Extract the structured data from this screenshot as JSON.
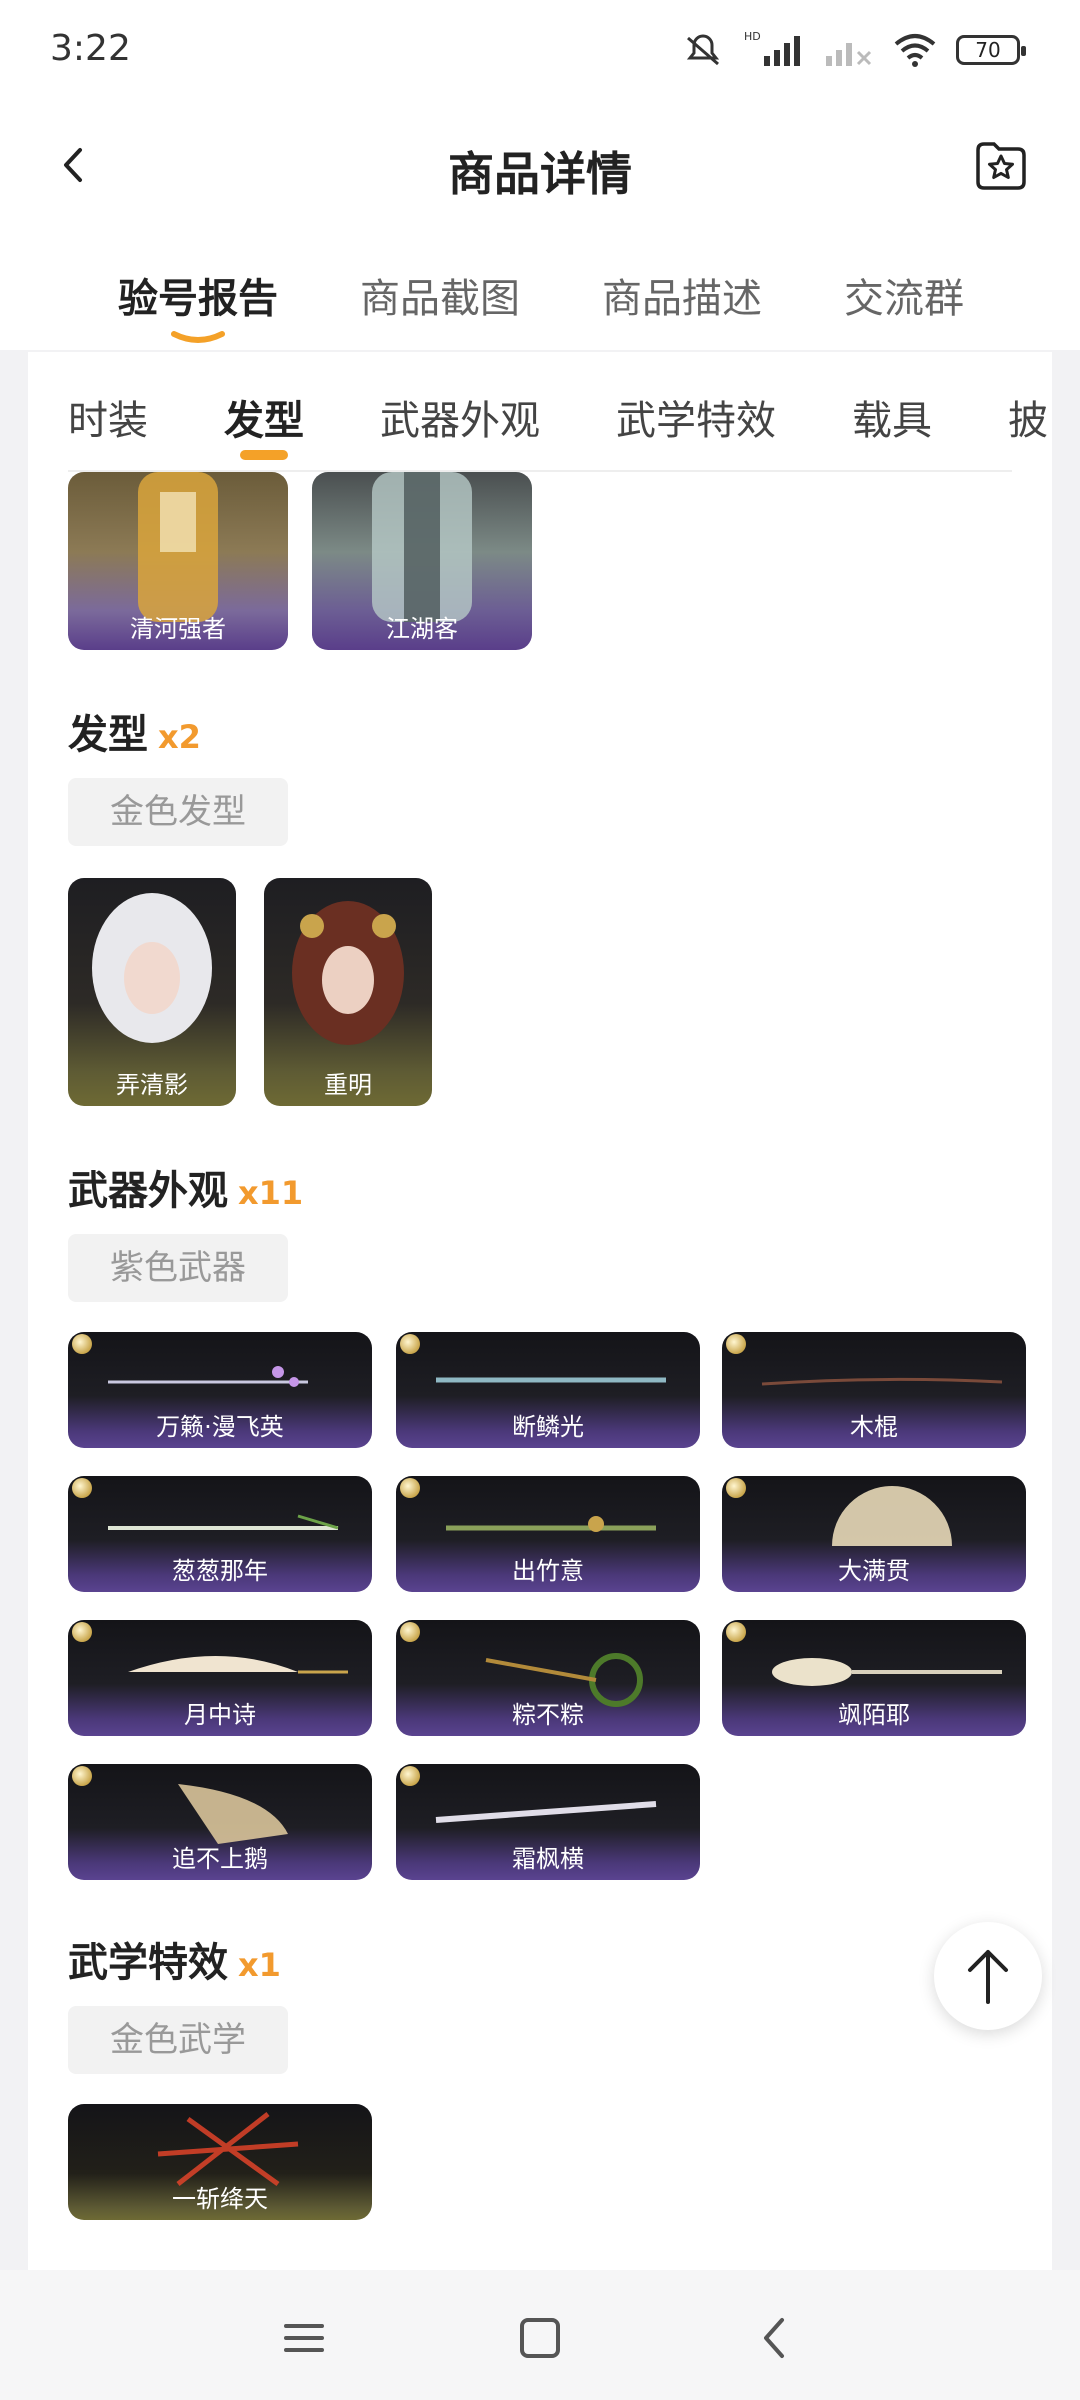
{
  "status_bar": {
    "time": "3:22",
    "battery": "70",
    "network_label": "HD"
  },
  "header": {
    "title": "商品详情"
  },
  "main_tabs": [
    {
      "label": "验号报告",
      "active": true
    },
    {
      "label": "商品截图",
      "active": false
    },
    {
      "label": "商品描述",
      "active": false
    },
    {
      "label": "交流群",
      "active": false
    }
  ],
  "sub_tabs": [
    {
      "label": "时装",
      "active": false
    },
    {
      "label": "发型",
      "active": true
    },
    {
      "label": "武器外观",
      "active": false
    },
    {
      "label": "武学特效",
      "active": false
    },
    {
      "label": "载具",
      "active": false
    },
    {
      "label": "披",
      "active": false
    }
  ],
  "outfits": [
    {
      "name": "清河强者"
    },
    {
      "name": "江湖客"
    }
  ],
  "hair": {
    "title": "发型",
    "count": "x2",
    "filter_chip": "金色发型",
    "items": [
      {
        "name": "弄清影"
      },
      {
        "name": "重明"
      }
    ]
  },
  "weapons": {
    "title": "武器外观",
    "count": "x11",
    "filter_chip": "紫色武器",
    "items": [
      {
        "name": "万籁·漫飞英"
      },
      {
        "name": "断鳞光"
      },
      {
        "name": "木棍"
      },
      {
        "name": "葱葱那年"
      },
      {
        "name": "出竹意"
      },
      {
        "name": "大满贯"
      },
      {
        "name": "月中诗"
      },
      {
        "name": "粽不粽"
      },
      {
        "name": "飒陌耶"
      },
      {
        "name": "追不上鹅"
      },
      {
        "name": "霜枫横"
      }
    ]
  },
  "wuxue": {
    "title": "武学特效",
    "count": "x1",
    "filter_chip": "金色武学",
    "items": [
      {
        "name": "一斩绛天"
      }
    ]
  },
  "colors": {
    "accent": "#f4a128",
    "count": "#f29a2e",
    "purple_fade": "#5a4390",
    "gold_fade": "#6e6a34"
  }
}
